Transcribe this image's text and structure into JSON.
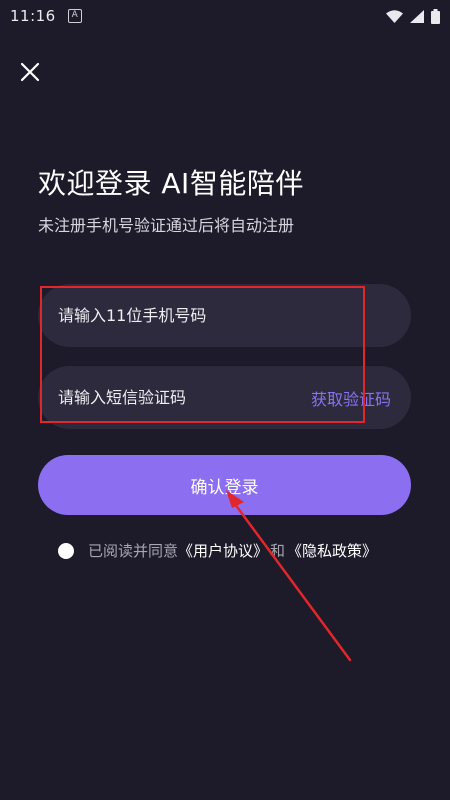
{
  "status_bar": {
    "time": "11:16",
    "notification_glyph": "A"
  },
  "header": {
    "title": "欢迎登录  AI智能陪伴",
    "subtitle": "未注册手机号验证通过后将自动注册"
  },
  "form": {
    "phone_placeholder": "请输入11位手机号码",
    "code_placeholder": "请输入短信验证码",
    "get_code_label": "获取验证码",
    "login_label": "确认登录"
  },
  "agreement": {
    "prefix": "已阅读并同意",
    "user_agreement": "《用户协议》",
    "connector": "和",
    "privacy_policy": "《隐私政策》"
  },
  "colors": {
    "background": "#1d1b2a",
    "field": "#2c2a3c",
    "accent": "#8b6ff0",
    "link_accent": "#8a72ee",
    "annotation_red": "#e3262a"
  },
  "icons": [
    "close-icon",
    "wifi-icon",
    "signal-icon",
    "battery-icon",
    "notification-icon"
  ]
}
